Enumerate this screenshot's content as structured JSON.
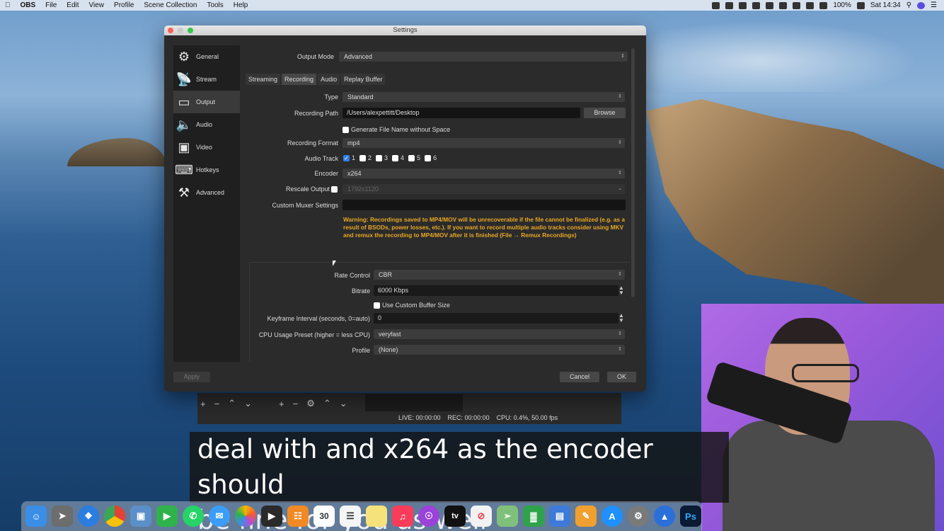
{
  "menubar": {
    "app": "OBS",
    "items": [
      "File",
      "Edit",
      "View",
      "Profile",
      "Scene Collection",
      "Tools",
      "Help"
    ],
    "battery": "100%",
    "clock": "Sat 14:34"
  },
  "settings": {
    "title": "Settings",
    "sidebar": [
      {
        "label": "General",
        "icon": "gear-icon"
      },
      {
        "label": "Stream",
        "icon": "antenna-icon"
      },
      {
        "label": "Output",
        "icon": "output-icon"
      },
      {
        "label": "Audio",
        "icon": "speaker-icon"
      },
      {
        "label": "Video",
        "icon": "monitor-icon"
      },
      {
        "label": "Hotkeys",
        "icon": "keyboard-icon"
      },
      {
        "label": "Advanced",
        "icon": "tools-icon"
      }
    ],
    "active_sidebar": "Output",
    "output_mode_label": "Output Mode",
    "output_mode_value": "Advanced",
    "tabs": [
      "Streaming",
      "Recording",
      "Audio",
      "Replay Buffer"
    ],
    "active_tab": "Recording",
    "type_label": "Type",
    "type_value": "Standard",
    "recording_path_label": "Recording Path",
    "recording_path_value": "/Users/alexpettitt/Desktop",
    "browse_label": "Browse",
    "gen_filename_label": "Generate File Name without Space",
    "recording_format_label": "Recording Format",
    "recording_format_value": "mp4",
    "audio_track_label": "Audio Track",
    "audio_tracks": [
      {
        "label": "1",
        "checked": true
      },
      {
        "label": "2",
        "checked": false
      },
      {
        "label": "3",
        "checked": false
      },
      {
        "label": "4",
        "checked": false
      },
      {
        "label": "5",
        "checked": false
      },
      {
        "label": "6",
        "checked": false
      }
    ],
    "encoder_label": "Encoder",
    "encoder_value": "x264",
    "rescale_label": "Rescale Output",
    "rescale_value": "1792x1120",
    "custom_muxer_label": "Custom Muxer Settings",
    "custom_muxer_value": "",
    "warning": "Warning: Recordings saved to MP4/MOV will be unrecoverable if the file cannot be finalized (e.g. as a result of BSODs, power losses, etc.). If you want to record multiple audio tracks consider using MKV and remux the recording to MP4/MOV after it is finished (File → Remux Recordings)",
    "rate_control_label": "Rate Control",
    "rate_control_value": "CBR",
    "bitrate_label": "Bitrate",
    "bitrate_value": "6000 Kbps",
    "custom_buffer_label": "Use Custom Buffer Size",
    "keyframe_label": "Keyframe Interval (seconds, 0=auto)",
    "keyframe_value": "0",
    "cpu_preset_label": "CPU Usage Preset (higher = less CPU)",
    "cpu_preset_value": "veryfast",
    "profile_label": "Profile",
    "profile_value": "(None)",
    "apply_label": "Apply",
    "cancel_label": "Cancel",
    "ok_label": "OK"
  },
  "obs_status": {
    "live": "LIVE: 00:00:00",
    "rec": "REC: 00:00:00",
    "cpu": "CPU: 0.4%, 50.00 fps"
  },
  "subtitle": {
    "line1": "deal with and x264 as the encoder should",
    "line2": "be fine for you as well"
  },
  "dock": {
    "icons": [
      "finder-icon",
      "launchpad-icon",
      "safari-icon",
      "chrome-icon",
      "preview-icon",
      "facetime-icon",
      "whatsapp-icon",
      "messages-icon",
      "photos-icon",
      "final-cut-icon",
      "books-icon",
      "calendar-icon",
      "notes-icon",
      "stickies-icon",
      "music-icon",
      "podcasts-icon",
      "apple-tv-icon",
      "news-icon",
      "maps-icon",
      "numbers-icon",
      "keynote-icon",
      "pages-icon",
      "app-store-icon",
      "system-preferences-icon",
      "instruments-icon",
      "photoshop-icon"
    ],
    "calendar_day": "30",
    "appletv_label": "tv",
    "photoshop_label": "Ps"
  }
}
